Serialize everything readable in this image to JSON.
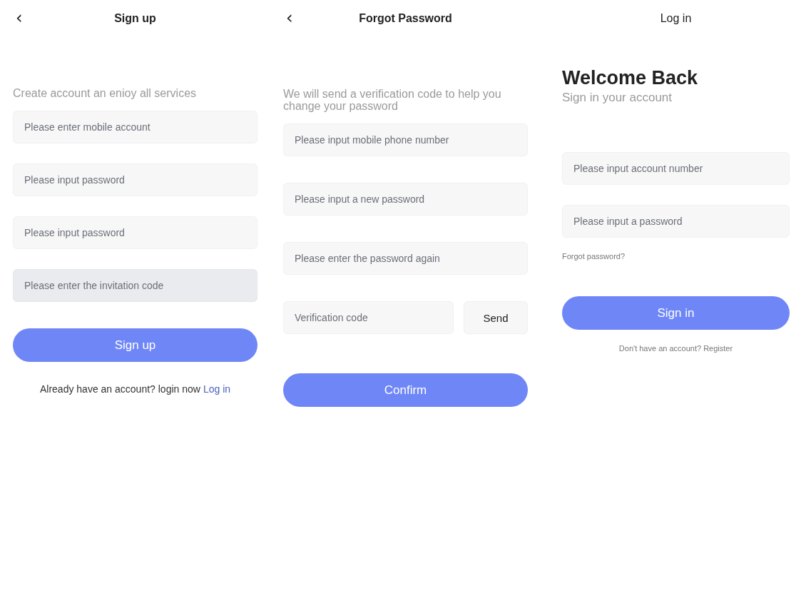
{
  "screens": [
    {
      "kind": "signup",
      "header": {
        "back": "‹",
        "title": "Sign up",
        "bold": true
      },
      "subtitle": "Create account an enioy all services",
      "fields": [
        {
          "placeholder": "Please enter mobile account",
          "highlighted": false
        },
        {
          "placeholder": "Please input password",
          "highlighted": false
        },
        {
          "placeholder": "Please input password",
          "highlighted": false
        },
        {
          "placeholder": "Please enter the invitation code",
          "highlighted": true
        }
      ],
      "submit": "Sign up",
      "footer": {
        "text": "Already have an account? login now",
        "link": "Log in"
      }
    },
    {
      "kind": "forgot",
      "header": {
        "back": "‹",
        "title": "Forgot Password",
        "bold": true
      },
      "subtitle": "We will send a verification code to help you change your password",
      "fields": [
        {
          "placeholder": "Please input mobile phone number",
          "highlighted": false
        },
        {
          "placeholder": "Please input a new password",
          "highlighted": false
        },
        {
          "placeholder": "Please enter the password again",
          "highlighted": false
        }
      ],
      "code": {
        "placeholder": "Verification code",
        "button": "Send"
      },
      "submit": "Confirm"
    },
    {
      "kind": "login",
      "header": {
        "title": "Log in",
        "bold": false
      },
      "heading": "Welcome Back",
      "subtitle": "Sign in your account",
      "fields": [
        {
          "placeholder": "Please input account number",
          "highlighted": false
        },
        {
          "placeholder": "Please input a password",
          "highlighted": false
        }
      ],
      "forgot_link": "Forgot password?",
      "submit": "Sign in",
      "footer": {
        "text": "Don't have an account? Register"
      }
    }
  ]
}
